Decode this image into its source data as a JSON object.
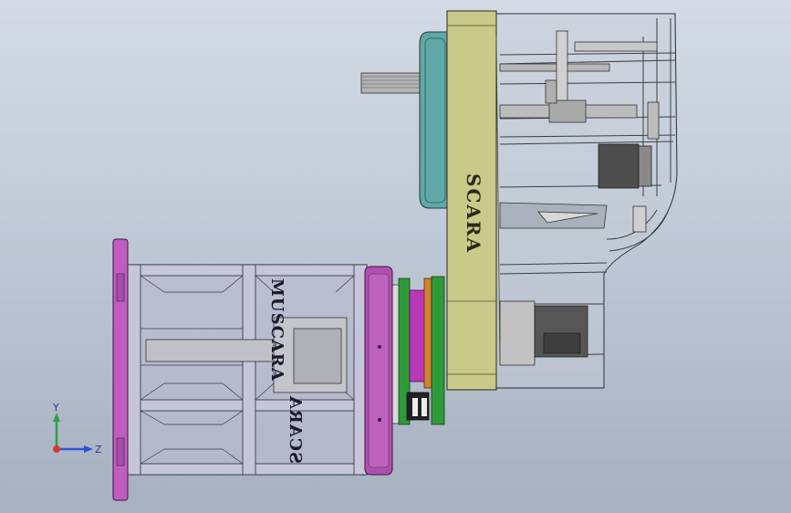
{
  "app": {
    "view": "CAD model viewport"
  },
  "engravings": {
    "arm_label": "SCARA",
    "base_label_top": "MUSCARA",
    "base_label_bottom": "SCARA"
  },
  "triad": {
    "y_label": "Y",
    "z_label": "Z"
  },
  "colors": {
    "background_top": "#d4dbe6",
    "background_bottom": "#a6b0bf",
    "arm_plate": "#c9c98a",
    "motor_cover": "#5fa8a6",
    "base_frame": "#b9b9cf",
    "base_flange": "#c05dc0",
    "joint_ring_green": "#2f9a3a",
    "joint_ring_magenta": "#b838b8",
    "joint_ring_orange": "#d4802c",
    "motor_dark": "#4a4a4a"
  }
}
